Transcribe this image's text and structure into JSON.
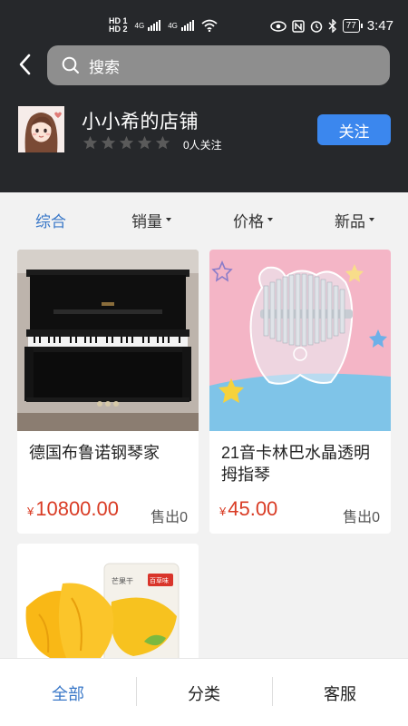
{
  "status_bar": {
    "time": "3:47",
    "battery": "77",
    "hd1": "HD 1",
    "hd2": "HD 2",
    "net1": "4G",
    "net2": "4G"
  },
  "search": {
    "placeholder": "搜索"
  },
  "shop": {
    "name": "小小希的店铺",
    "rating_stars": 0,
    "rating_max": 5,
    "followers_text": "0人关注",
    "follow_label": "关注"
  },
  "sort_tabs": [
    {
      "label": "综合",
      "active": true,
      "has_caret": false
    },
    {
      "label": "销量",
      "active": false,
      "has_caret": true
    },
    {
      "label": "价格",
      "active": false,
      "has_caret": true
    },
    {
      "label": "新品",
      "active": false,
      "has_caret": true
    }
  ],
  "products": [
    {
      "title": "德国布鲁诺钢琴家",
      "currency": "¥",
      "price": "10800.00",
      "sold": "售出0",
      "image": "piano-image"
    },
    {
      "title": "21音卡林巴水晶透明拇指琴",
      "currency": "¥",
      "price": "45.00",
      "sold": "售出0",
      "image": "kalimba-image"
    },
    {
      "title": "",
      "currency": "",
      "price": "",
      "sold": "",
      "image": "dried-mango-image",
      "package_text": "芒果干",
      "brand_text": "百草味"
    }
  ],
  "bottom_nav": [
    {
      "label": "全部",
      "active": true
    },
    {
      "label": "分类",
      "active": false
    },
    {
      "label": "客服",
      "active": false
    }
  ],
  "colors": {
    "header_bg": "#26282b",
    "accent": "#3a78c8",
    "follow_button": "#3b87ee",
    "price": "#d93c25"
  }
}
